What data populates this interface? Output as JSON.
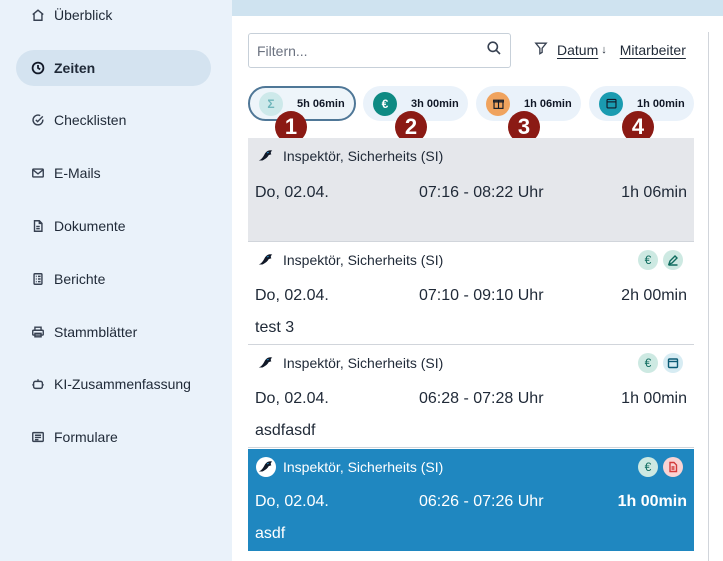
{
  "sidebar": {
    "items": [
      {
        "label": "Überblick",
        "icon": "home-icon"
      },
      {
        "label": "Zeiten",
        "icon": "clock-icon",
        "active": true
      },
      {
        "label": "Checklisten",
        "icon": "check-circle-icon"
      },
      {
        "label": "E-Mails",
        "icon": "mail-icon"
      },
      {
        "label": "Dokumente",
        "icon": "document-icon"
      },
      {
        "label": "Berichte",
        "icon": "report-icon"
      },
      {
        "label": "Stammblätter",
        "icon": "printer-icon"
      },
      {
        "label": "KI-Zusammenfassung",
        "icon": "robot-icon"
      },
      {
        "label": "Formulare",
        "icon": "form-icon"
      }
    ]
  },
  "filter": {
    "placeholder": "Filtern...",
    "value": ""
  },
  "sort": {
    "field": "Datum",
    "direction_glyph": "↓",
    "group": "Mitarbeiter"
  },
  "summary": [
    {
      "value": "5h 06min",
      "icon": "sigma-icon",
      "color": "#cde9ea",
      "icon_color": "#ffffff",
      "marker": "1"
    },
    {
      "value": "3h 00min",
      "icon": "euro-icon",
      "color": "#0e8a83",
      "icon_color": "#ffffff",
      "marker": "2"
    },
    {
      "value": "1h 06min",
      "icon": "gift-icon",
      "color": "#f0a35e",
      "icon_color": "#ffffff",
      "marker": "3"
    },
    {
      "value": "1h 00min",
      "icon": "calendar-icon",
      "color": "#1a9bb0",
      "icon_color": "#ffffff",
      "marker": "4"
    }
  ],
  "entries": [
    {
      "name": "Inspektör, Sicherheits (SI)",
      "date": "Do, 02.04.",
      "time": "07:16 - 08:22 Uhr",
      "duration": "1h 06min",
      "note": "",
      "badges": [],
      "state": "highlighted"
    },
    {
      "name": "Inspektör, Sicherheits (SI)",
      "date": "Do, 02.04.",
      "time": "07:10 - 09:10 Uhr",
      "duration": "2h 00min",
      "note": "test 3",
      "badges": [
        "euro-icon",
        "signature-icon"
      ],
      "state": "normal"
    },
    {
      "name": "Inspektör, Sicherheits (SI)",
      "date": "Do, 02.04.",
      "time": "06:28 - 07:28 Uhr",
      "duration": "1h 00min",
      "note": "asdfasdf",
      "badges": [
        "euro-icon",
        "calendar-icon"
      ],
      "state": "normal"
    },
    {
      "name": "Inspektör, Sicherheits (SI)",
      "date": "Do, 02.04.",
      "time": "06:26 - 07:26 Uhr",
      "duration": "1h 00min",
      "note": "asdf",
      "badges": [
        "euro-icon",
        "pdf-icon"
      ],
      "state": "selected"
    }
  ],
  "colors": {
    "sidebar_bg": "#eaf2fa",
    "active_nav": "#d4e3f0",
    "selected_row": "#1f87c0",
    "highlight_row": "#e5e7eb",
    "marker": "#8b1a14"
  }
}
